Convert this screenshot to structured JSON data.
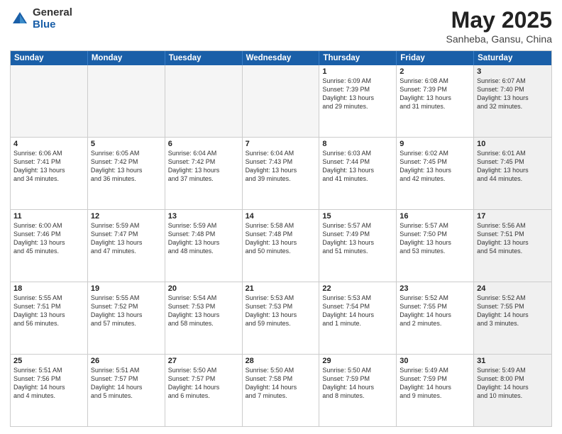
{
  "header": {
    "logo_general": "General",
    "logo_blue": "Blue",
    "title": "May 2025",
    "location": "Sanheba, Gansu, China"
  },
  "weekdays": [
    "Sunday",
    "Monday",
    "Tuesday",
    "Wednesday",
    "Thursday",
    "Friday",
    "Saturday"
  ],
  "rows": [
    [
      {
        "date": "",
        "info": "",
        "empty": true
      },
      {
        "date": "",
        "info": "",
        "empty": true
      },
      {
        "date": "",
        "info": "",
        "empty": true
      },
      {
        "date": "",
        "info": "",
        "empty": true
      },
      {
        "date": "1",
        "info": "Sunrise: 6:09 AM\nSunset: 7:39 PM\nDaylight: 13 hours\nand 29 minutes."
      },
      {
        "date": "2",
        "info": "Sunrise: 6:08 AM\nSunset: 7:39 PM\nDaylight: 13 hours\nand 31 minutes."
      },
      {
        "date": "3",
        "info": "Sunrise: 6:07 AM\nSunset: 7:40 PM\nDaylight: 13 hours\nand 32 minutes.",
        "shaded": true
      }
    ],
    [
      {
        "date": "4",
        "info": "Sunrise: 6:06 AM\nSunset: 7:41 PM\nDaylight: 13 hours\nand 34 minutes."
      },
      {
        "date": "5",
        "info": "Sunrise: 6:05 AM\nSunset: 7:42 PM\nDaylight: 13 hours\nand 36 minutes."
      },
      {
        "date": "6",
        "info": "Sunrise: 6:04 AM\nSunset: 7:42 PM\nDaylight: 13 hours\nand 37 minutes."
      },
      {
        "date": "7",
        "info": "Sunrise: 6:04 AM\nSunset: 7:43 PM\nDaylight: 13 hours\nand 39 minutes."
      },
      {
        "date": "8",
        "info": "Sunrise: 6:03 AM\nSunset: 7:44 PM\nDaylight: 13 hours\nand 41 minutes."
      },
      {
        "date": "9",
        "info": "Sunrise: 6:02 AM\nSunset: 7:45 PM\nDaylight: 13 hours\nand 42 minutes."
      },
      {
        "date": "10",
        "info": "Sunrise: 6:01 AM\nSunset: 7:45 PM\nDaylight: 13 hours\nand 44 minutes.",
        "shaded": true
      }
    ],
    [
      {
        "date": "11",
        "info": "Sunrise: 6:00 AM\nSunset: 7:46 PM\nDaylight: 13 hours\nand 45 minutes."
      },
      {
        "date": "12",
        "info": "Sunrise: 5:59 AM\nSunset: 7:47 PM\nDaylight: 13 hours\nand 47 minutes."
      },
      {
        "date": "13",
        "info": "Sunrise: 5:59 AM\nSunset: 7:48 PM\nDaylight: 13 hours\nand 48 minutes."
      },
      {
        "date": "14",
        "info": "Sunrise: 5:58 AM\nSunset: 7:48 PM\nDaylight: 13 hours\nand 50 minutes."
      },
      {
        "date": "15",
        "info": "Sunrise: 5:57 AM\nSunset: 7:49 PM\nDaylight: 13 hours\nand 51 minutes."
      },
      {
        "date": "16",
        "info": "Sunrise: 5:57 AM\nSunset: 7:50 PM\nDaylight: 13 hours\nand 53 minutes."
      },
      {
        "date": "17",
        "info": "Sunrise: 5:56 AM\nSunset: 7:51 PM\nDaylight: 13 hours\nand 54 minutes.",
        "shaded": true
      }
    ],
    [
      {
        "date": "18",
        "info": "Sunrise: 5:55 AM\nSunset: 7:51 PM\nDaylight: 13 hours\nand 56 minutes."
      },
      {
        "date": "19",
        "info": "Sunrise: 5:55 AM\nSunset: 7:52 PM\nDaylight: 13 hours\nand 57 minutes."
      },
      {
        "date": "20",
        "info": "Sunrise: 5:54 AM\nSunset: 7:53 PM\nDaylight: 13 hours\nand 58 minutes."
      },
      {
        "date": "21",
        "info": "Sunrise: 5:53 AM\nSunset: 7:53 PM\nDaylight: 13 hours\nand 59 minutes."
      },
      {
        "date": "22",
        "info": "Sunrise: 5:53 AM\nSunset: 7:54 PM\nDaylight: 14 hours\nand 1 minute."
      },
      {
        "date": "23",
        "info": "Sunrise: 5:52 AM\nSunset: 7:55 PM\nDaylight: 14 hours\nand 2 minutes."
      },
      {
        "date": "24",
        "info": "Sunrise: 5:52 AM\nSunset: 7:55 PM\nDaylight: 14 hours\nand 3 minutes.",
        "shaded": true
      }
    ],
    [
      {
        "date": "25",
        "info": "Sunrise: 5:51 AM\nSunset: 7:56 PM\nDaylight: 14 hours\nand 4 minutes."
      },
      {
        "date": "26",
        "info": "Sunrise: 5:51 AM\nSunset: 7:57 PM\nDaylight: 14 hours\nand 5 minutes."
      },
      {
        "date": "27",
        "info": "Sunrise: 5:50 AM\nSunset: 7:57 PM\nDaylight: 14 hours\nand 6 minutes."
      },
      {
        "date": "28",
        "info": "Sunrise: 5:50 AM\nSunset: 7:58 PM\nDaylight: 14 hours\nand 7 minutes."
      },
      {
        "date": "29",
        "info": "Sunrise: 5:50 AM\nSunset: 7:59 PM\nDaylight: 14 hours\nand 8 minutes."
      },
      {
        "date": "30",
        "info": "Sunrise: 5:49 AM\nSunset: 7:59 PM\nDaylight: 14 hours\nand 9 minutes."
      },
      {
        "date": "31",
        "info": "Sunrise: 5:49 AM\nSunset: 8:00 PM\nDaylight: 14 hours\nand 10 minutes.",
        "shaded": true
      }
    ]
  ]
}
